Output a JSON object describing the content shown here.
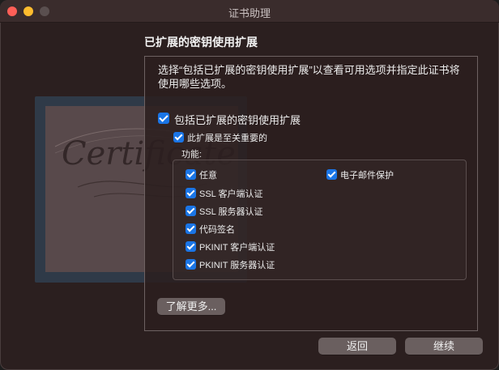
{
  "window": {
    "title": "证书助理"
  },
  "heading": "已扩展的密钥使用扩展",
  "description": "选择“包括已扩展的密钥使用扩展”以查看可用选项并指定此证书将使用哪些选项。",
  "include_extension": {
    "label": "包括已扩展的密钥使用扩展",
    "checked": true
  },
  "critical_extension": {
    "label": "此扩展是至关重要的",
    "checked": true
  },
  "features_label": "功能:",
  "features": [
    {
      "label": "任意",
      "checked": true
    },
    {
      "label": "SSL 客户端认证",
      "checked": true
    },
    {
      "label": "SSL 服务器认证",
      "checked": true
    },
    {
      "label": "代码签名",
      "checked": true
    },
    {
      "label": "PKINIT 客户端认证",
      "checked": true
    },
    {
      "label": "PKINIT 服务器认证",
      "checked": true
    },
    {
      "label": "电子邮件保护",
      "checked": true
    }
  ],
  "buttons": {
    "learn_more": "了解更多...",
    "back": "返回",
    "continue": "继续"
  },
  "illustration": {
    "script_text": "Certificate"
  }
}
